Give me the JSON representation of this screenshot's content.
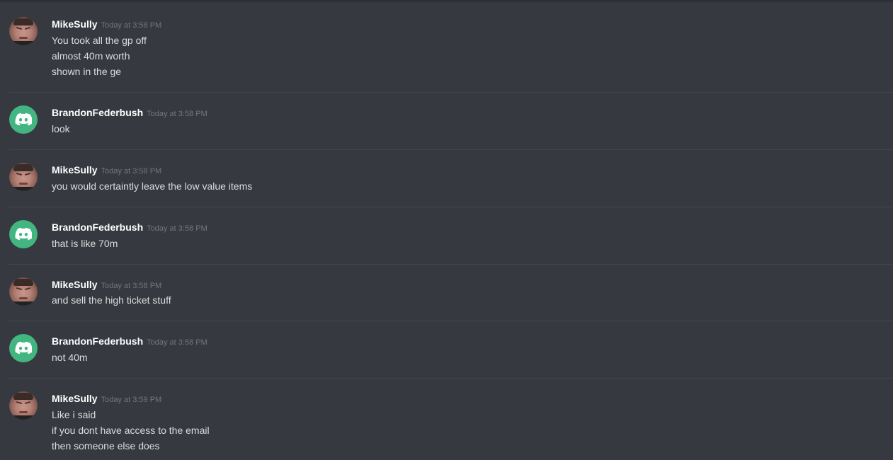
{
  "messages": [
    {
      "author": "MikeSully",
      "avatar": "user-photo-avatar",
      "timestamp": "Today at 3:58 PM",
      "lines": [
        "You took all the gp off",
        "almost 40m worth",
        "shown in the ge"
      ]
    },
    {
      "author": "BrandonFederbush",
      "avatar": "discord-logo-avatar",
      "timestamp": "Today at 3:58 PM",
      "lines": [
        "look"
      ]
    },
    {
      "author": "MikeSully",
      "avatar": "user-photo-avatar",
      "timestamp": "Today at 3:58 PM",
      "lines": [
        "you would certaintly leave the low value items"
      ]
    },
    {
      "author": "BrandonFederbush",
      "avatar": "discord-logo-avatar",
      "timestamp": "Today at 3:58 PM",
      "lines": [
        "that is like 70m"
      ]
    },
    {
      "author": "MikeSully",
      "avatar": "user-photo-avatar",
      "timestamp": "Today at 3:58 PM",
      "lines": [
        "and sell the high ticket stuff"
      ]
    },
    {
      "author": "BrandonFederbush",
      "avatar": "discord-logo-avatar",
      "timestamp": "Today at 3:58 PM",
      "lines": [
        "not 40m"
      ]
    },
    {
      "author": "MikeSully",
      "avatar": "user-photo-avatar",
      "timestamp": "Today at 3:59 PM",
      "lines": [
        "Like i said",
        "if you dont have access to the email",
        "then someone else does"
      ]
    }
  ],
  "colors": {
    "background": "#36393f",
    "discord_avatar": "#43b581",
    "username": "#ffffff",
    "message_text": "#dcddde",
    "timestamp": "#72767d"
  }
}
